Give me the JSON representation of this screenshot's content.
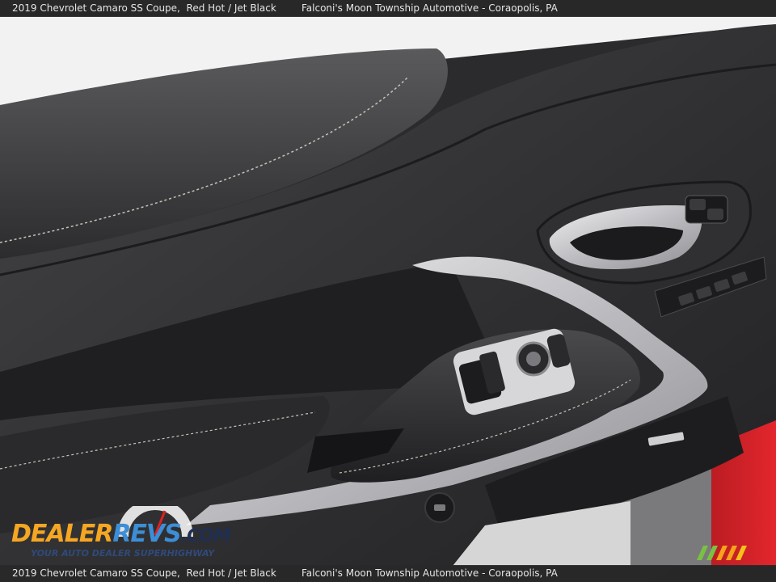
{
  "caption": {
    "vehicle": "2019 Chevrolet Camaro SS Coupe,",
    "color": "Red Hot / Jet Black",
    "dealer": "Falconi's Moon Township Automotive - Coraopolis, PA"
  },
  "watermark": {
    "logo_text": "DealerRevs.com",
    "tagline": "Your Auto Dealer SuperHighway"
  },
  "scene": {
    "subject": "car-door-interior-panel",
    "colors": {
      "trim": "#c9c9cb",
      "panel": "#2a2a2c",
      "leather": "#3a3a3c",
      "body_red": "#d8232a"
    }
  }
}
